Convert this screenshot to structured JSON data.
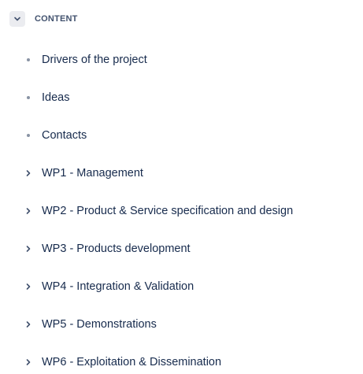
{
  "section": {
    "title": "CONTENT"
  },
  "items": [
    {
      "label": "Drivers of the project",
      "marker": "bullet"
    },
    {
      "label": "Ideas",
      "marker": "bullet"
    },
    {
      "label": "Contacts",
      "marker": "bullet"
    },
    {
      "label": "WP1 - Management",
      "marker": "chevron"
    },
    {
      "label": "WP2 - Product & Service specification and design",
      "marker": "chevron"
    },
    {
      "label": "WP3 - Products development",
      "marker": "chevron"
    },
    {
      "label": "WP4 - Integration & Validation",
      "marker": "chevron"
    },
    {
      "label": "WP5 - Demonstrations",
      "marker": "chevron"
    },
    {
      "label": "WP6 - Exploitation & Dissemination",
      "marker": "chevron"
    }
  ],
  "colors": {
    "text": "#172b4d",
    "header_text": "#42526e",
    "marker": "#8993a4",
    "button_bg": "#ebecf0"
  }
}
